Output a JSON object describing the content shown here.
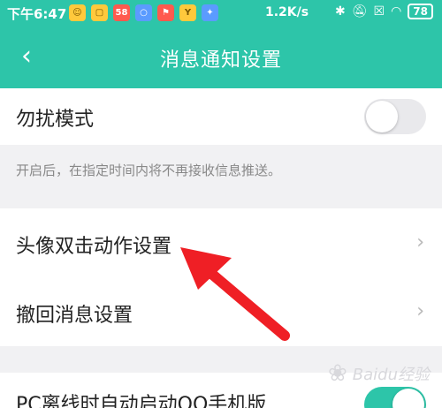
{
  "status_bar": {
    "time": "下午6:47",
    "app_icons": [
      {
        "name": "smile-app-icon",
        "glyph": "☺"
      },
      {
        "name": "shop-app-icon",
        "glyph": "▢"
      },
      {
        "name": "58-app-icon",
        "glyph": "58"
      },
      {
        "name": "circle-app-icon",
        "glyph": "○"
      },
      {
        "name": "map-pin-app-icon",
        "glyph": "⚑"
      },
      {
        "name": "y-app-icon",
        "glyph": "Y"
      },
      {
        "name": "wing-app-icon",
        "glyph": "✦"
      }
    ],
    "net_speed": "1.2K/s",
    "battery_level": "78"
  },
  "header": {
    "title": "消息通知设置",
    "back_glyph": "‹"
  },
  "settings": {
    "dnd": {
      "label": "勿扰模式",
      "enabled": false
    },
    "dnd_hint": "开启后，在指定时间内将不再接收信息推送。",
    "double_tap": {
      "label": "头像双击动作设置"
    },
    "recall": {
      "label": "撤回消息设置"
    },
    "pc_offline": {
      "label": "PC离线时自动启动QQ手机版",
      "enabled": true
    }
  },
  "chevron_glyph": "›",
  "watermark": {
    "text": "Baidu经验"
  },
  "colors": {
    "accent": "#2dc5a9",
    "arrow": "#ef1f25"
  }
}
